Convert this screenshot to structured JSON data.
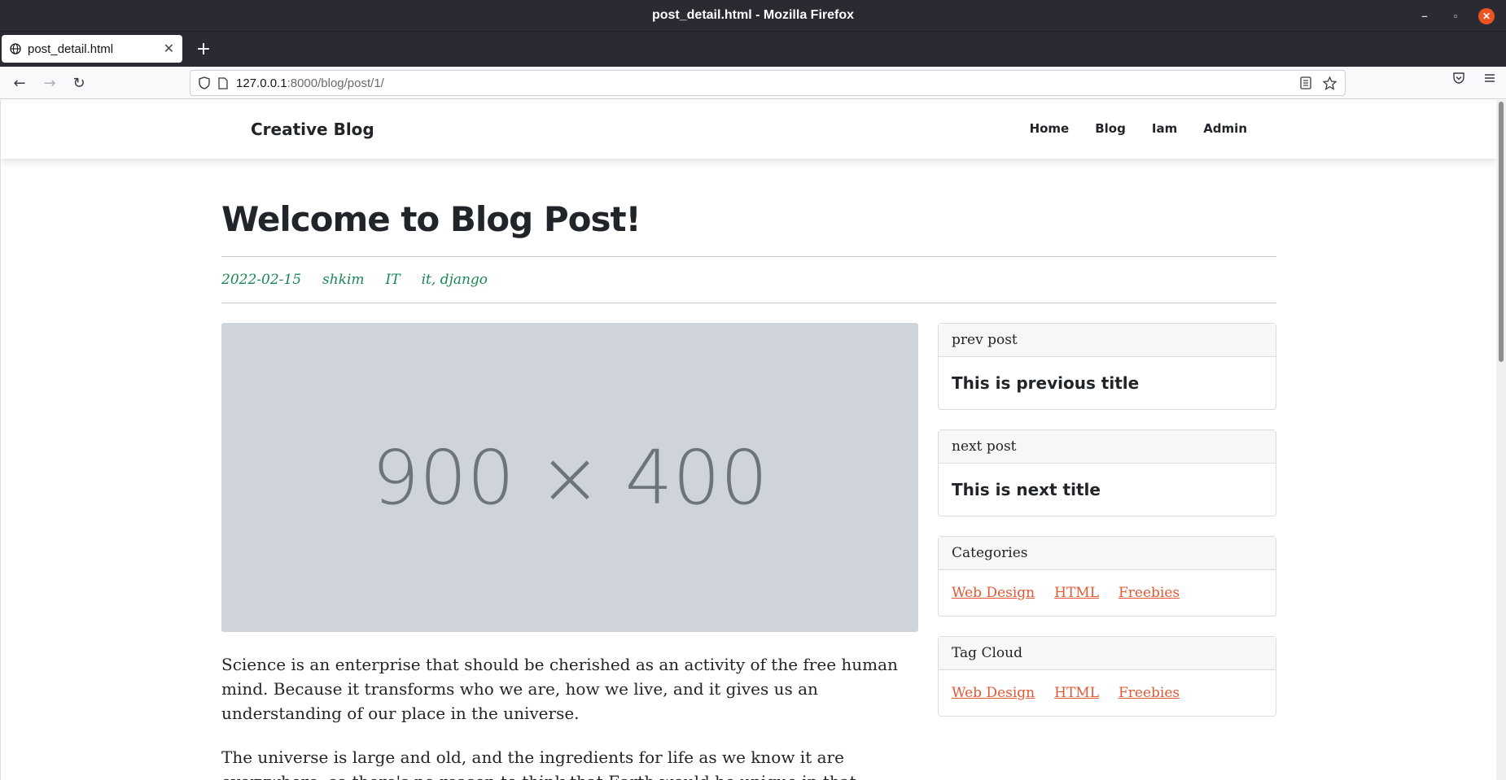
{
  "window": {
    "title": "post_detail.html - Mozilla Firefox",
    "controls": {
      "minimize": "–",
      "maximize": "▫",
      "close": "✕"
    }
  },
  "tabs": [
    {
      "title": "post_detail.html",
      "icon": "globe-icon",
      "close": "✕"
    }
  ],
  "toolbar": {
    "new_tab": "+",
    "back": "←",
    "forward": "→",
    "reload": "↻",
    "url_host": "127.0.0.1",
    "url_path": ":8000/blog/post/1/",
    "icons": [
      "shield-icon",
      "page-icon",
      "reader-view-icon",
      "bookmark-star-icon",
      "pocket-icon",
      "menu-icon"
    ]
  },
  "site": {
    "brand": "Creative Blog",
    "menu": [
      "Home",
      "Blog",
      "Iam",
      "Admin"
    ]
  },
  "post": {
    "title": "Welcome to Blog Post!",
    "date": "2022-02-15",
    "author": "shkim",
    "category": "IT",
    "tags": "it, django",
    "image_placeholder": "900 × 400",
    "paragraphs": [
      "Science is an enterprise that should be cherished as an activity of the free human mind. Because it transforms who we are, how we live, and it gives us an understanding of our place in the universe.",
      "The universe is large and old, and the ingredients for life as we know it are everywhere, so there's no reason to think that Earth would be unique in that regard. Whether of not"
    ]
  },
  "sidebar": {
    "prev": {
      "header": "prev post",
      "title": "This is previous title"
    },
    "next": {
      "header": "next post",
      "title": "This is next title"
    },
    "categories": {
      "header": "Categories",
      "links": [
        "Web Design",
        "HTML",
        "Freebies"
      ]
    },
    "tag_cloud": {
      "header": "Tag Cloud",
      "links": [
        "Web Design",
        "HTML",
        "Freebies"
      ]
    }
  },
  "colors": {
    "meta_green": "#1a8754",
    "link_orange": "#e25a35",
    "image_bg": "#ced4da",
    "titlebar": "#2b2a33"
  }
}
